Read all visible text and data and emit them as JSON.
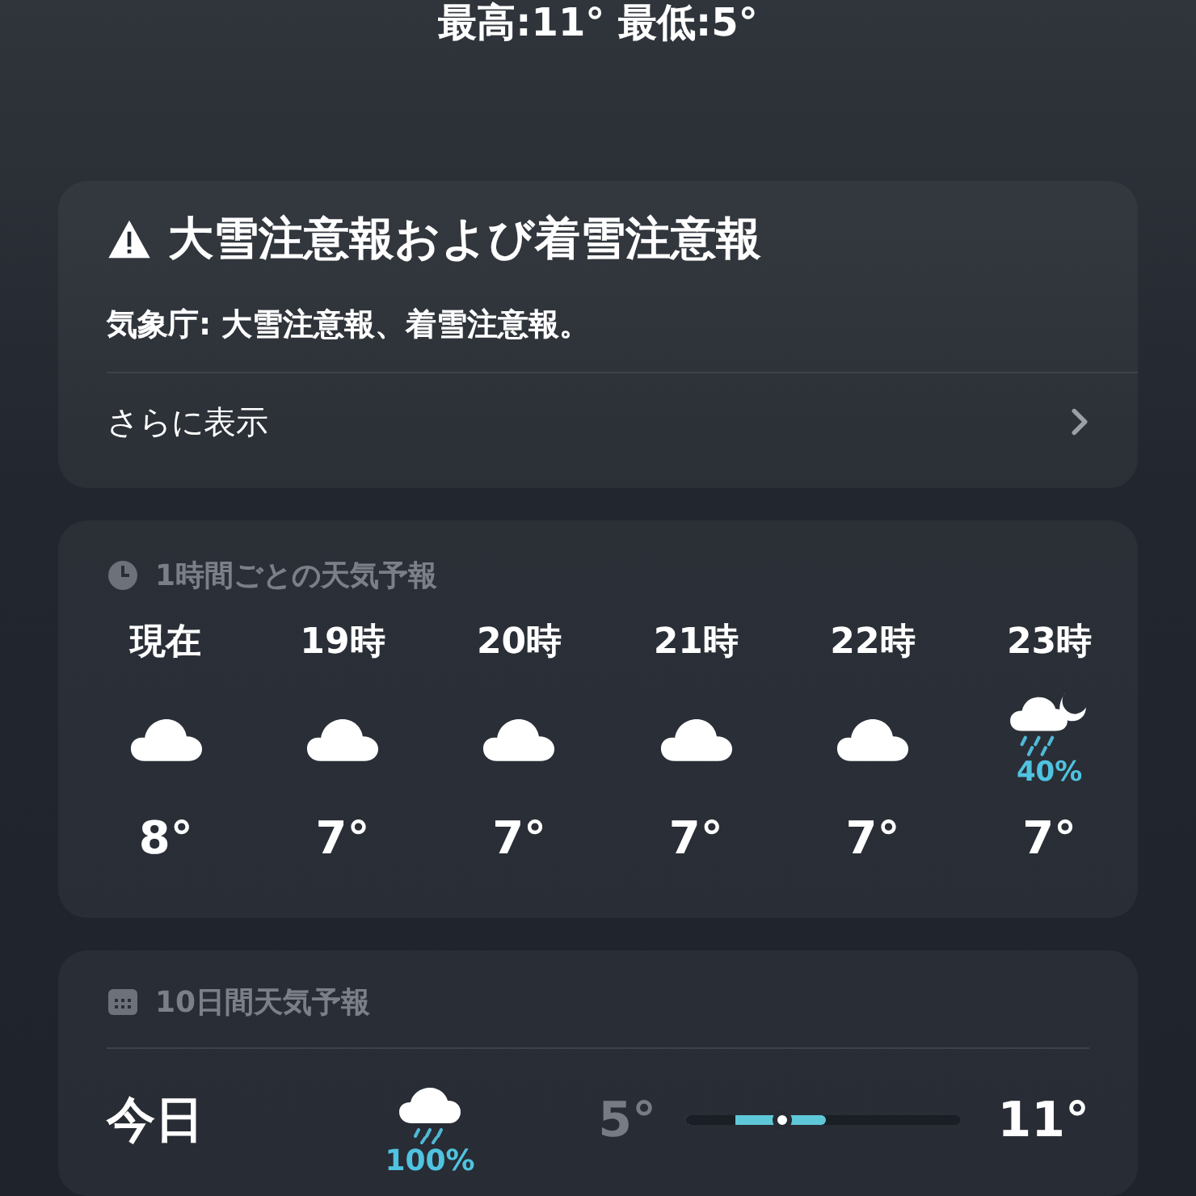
{
  "header": {
    "high_low": "最高:11° 最低:5°"
  },
  "alert": {
    "title": "大雪注意報および着雪注意報",
    "body": "気象庁: 大雪注意報、着雪注意報。",
    "more": "さらに表示"
  },
  "hourly": {
    "title": "1時間ごとの天気予報",
    "items": [
      {
        "time": "現在",
        "kind": "cloud",
        "temp": "8°"
      },
      {
        "time": "19時",
        "kind": "cloud",
        "temp": "7°"
      },
      {
        "time": "20時",
        "kind": "cloud",
        "temp": "7°"
      },
      {
        "time": "21時",
        "kind": "cloud",
        "temp": "7°"
      },
      {
        "time": "22時",
        "kind": "cloud",
        "temp": "7°"
      },
      {
        "time": "23時",
        "kind": "rain-moon",
        "precip": "40%",
        "temp": "7°"
      }
    ]
  },
  "daily": {
    "title": "10日間天気予報",
    "days": [
      {
        "day": "今日",
        "kind": "rain",
        "precip": "100%",
        "low": "5°",
        "high": "11°",
        "bar_start": {
          "level": 0.18
        },
        "bar_end": {
          "level": 0.51
        },
        "current": {
          "level": 0.35
        }
      }
    ]
  }
}
